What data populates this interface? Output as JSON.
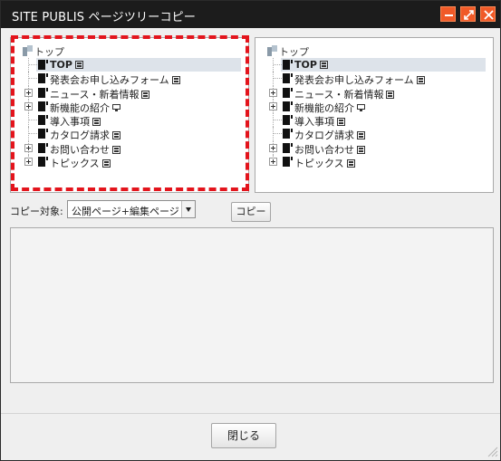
{
  "window": {
    "title": "SITE PUBLIS ページツリーコピー",
    "buttons": {
      "minimize_icon": "minimize-icon",
      "maximize_icon": "maximize-icon",
      "close_icon": "close-icon"
    },
    "accent_color": "#f05a28",
    "titlebar_color": "#1c1c1c"
  },
  "left_tree": {
    "root_label": "トップ",
    "highlight_color": "#e3141c",
    "nodes": [
      {
        "label": "TOP",
        "bold": true,
        "selected": true,
        "expandable": false,
        "status_icon": "published-icon"
      },
      {
        "label": "発表会お申し込みフォーム",
        "expandable": false,
        "status_icon": "published-icon"
      },
      {
        "label": "ニュース・新着情報",
        "expandable": true,
        "status_icon": "published-icon"
      },
      {
        "label": "新機能の紹介",
        "expandable": true,
        "status_icon": "draft-icon"
      },
      {
        "label": "導入事項",
        "expandable": false,
        "status_icon": "published-icon"
      },
      {
        "label": "カタログ請求",
        "expandable": false,
        "status_icon": "published-icon"
      },
      {
        "label": "お問い合わせ",
        "expandable": true,
        "status_icon": "published-icon"
      },
      {
        "label": "トピックス",
        "expandable": true,
        "status_icon": "published-icon"
      }
    ]
  },
  "right_tree": {
    "root_label": "トップ",
    "nodes": [
      {
        "label": "TOP",
        "bold": true,
        "selected": true,
        "expandable": false,
        "status_icon": "published-icon"
      },
      {
        "label": "発表会お申し込みフォーム",
        "expandable": false,
        "status_icon": "published-icon"
      },
      {
        "label": "ニュース・新着情報",
        "expandable": true,
        "status_icon": "published-icon"
      },
      {
        "label": "新機能の紹介",
        "expandable": true,
        "status_icon": "draft-icon"
      },
      {
        "label": "導入事項",
        "expandable": false,
        "status_icon": "published-icon"
      },
      {
        "label": "カタログ請求",
        "expandable": false,
        "status_icon": "published-icon"
      },
      {
        "label": "お問い合わせ",
        "expandable": true,
        "status_icon": "published-icon"
      },
      {
        "label": "トピックス",
        "expandable": true,
        "status_icon": "published-icon"
      }
    ]
  },
  "controls": {
    "copy_target_label": "コピー対象:",
    "copy_target_value": "公開ページ+編集ページ",
    "copy_button": "コピー"
  },
  "footer": {
    "close_button": "閉じる"
  }
}
